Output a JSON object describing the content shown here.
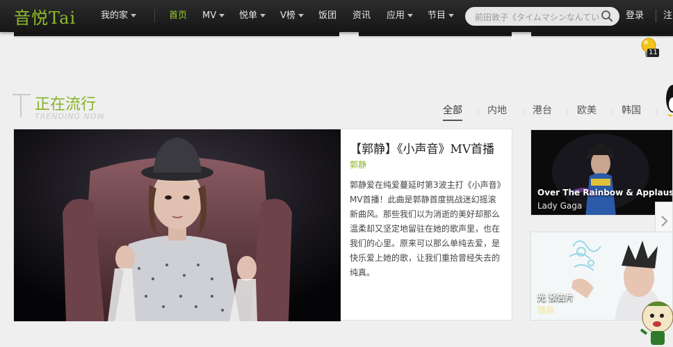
{
  "nav": {
    "logo": "音悦Tai",
    "items": [
      {
        "label": "我的家",
        "dropdown": true
      },
      {
        "label": "首页",
        "active": true
      },
      {
        "label": "MV",
        "dropdown": true
      },
      {
        "label": "悦单",
        "dropdown": true
      },
      {
        "label": "V榜",
        "dropdown": true
      },
      {
        "label": "饭团"
      },
      {
        "label": "资讯"
      },
      {
        "label": "应用",
        "dropdown": true
      },
      {
        "label": "节目",
        "dropdown": true
      }
    ],
    "search_placeholder": "前田敦子《タイムマシンなんていらない》",
    "login": "登录",
    "register": "注"
  },
  "notification": {
    "count": "11"
  },
  "section": {
    "title": "正在流行",
    "subtitle": "TRENDING NOW",
    "tabs": [
      "全部",
      "内地",
      "港台",
      "欧美",
      "韩国"
    ],
    "active_tab": "全部"
  },
  "feature": {
    "title": "【郭静】《小声音》MV首播",
    "artist": "郭静",
    "description": "郭静爱在纯爱蔓延时第3波主打《小声音》MV首播！此曲是郭静首度挑战迷幻摇滚新曲风。那些我们以为消逝的美好却那么温柔却又坚定地留驻在她的歌声里，也在我们的心里。原来可以那么单纯去爱，是快乐爱上她的歌，让我们重拾曾经失去的纯真。"
  },
  "side": [
    {
      "title": "Over The Rainbow & Applause...",
      "artist": "Lady Gaga"
    },
    {
      "title": "光 预告片",
      "artist": "魏晨"
    }
  ],
  "colors": {
    "accent": "#86b329",
    "nav_bg": "#1e1e1e",
    "page_bg": "#efefef"
  }
}
